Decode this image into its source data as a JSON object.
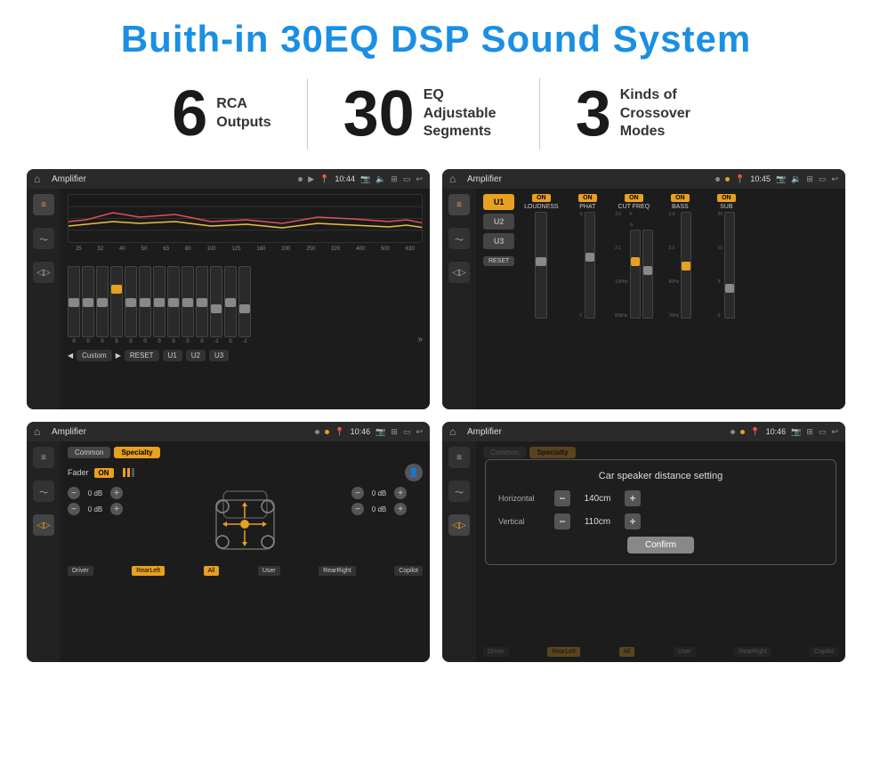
{
  "title": "Buith-in 30EQ DSP Sound System",
  "stats": [
    {
      "number": "6",
      "label": "RCA\nOutputs"
    },
    {
      "number": "30",
      "label": "EQ Adjustable\nSegments"
    },
    {
      "number": "3",
      "label": "Kinds of\nCrossover Modes"
    }
  ],
  "screens": [
    {
      "id": "eq-screen",
      "title": "Amplifier",
      "time": "10:44",
      "description": "30-band EQ screen",
      "freq_labels": [
        "25",
        "32",
        "40",
        "50",
        "63",
        "80",
        "100",
        "125",
        "160",
        "200",
        "250",
        "320",
        "400",
        "500",
        "630"
      ],
      "slider_values": [
        "0",
        "0",
        "0",
        "5",
        "0",
        "0",
        "0",
        "0",
        "0",
        "0",
        "-1",
        "0",
        "-1"
      ],
      "buttons": [
        "Custom",
        "RESET",
        "U1",
        "U2",
        "U3"
      ]
    },
    {
      "id": "crossover-screen",
      "title": "Amplifier",
      "time": "10:45",
      "description": "Crossover modes screen",
      "u_buttons": [
        "U1",
        "U2",
        "U3"
      ],
      "channels": [
        "LOUDNESS",
        "PHAT",
        "CUT FREQ",
        "BASS",
        "SUB"
      ],
      "channel_states": [
        "ON",
        "ON",
        "ON",
        "ON",
        "ON"
      ]
    },
    {
      "id": "fader-screen",
      "title": "Amplifier",
      "time": "10:46",
      "description": "Fader control screen",
      "tabs": [
        "Common",
        "Specialty"
      ],
      "fader_label": "Fader",
      "fader_on": "ON",
      "db_values": [
        "0 dB",
        "0 dB",
        "0 dB",
        "0 dB"
      ],
      "bottom_labels": [
        "Driver",
        "RearLeft",
        "All",
        "User",
        "RearRight",
        "Copilot"
      ]
    },
    {
      "id": "distance-screen",
      "title": "Amplifier",
      "time": "10:46",
      "description": "Car speaker distance setting",
      "dialog_title": "Car speaker distance setting",
      "horizontal_label": "Horizontal",
      "horizontal_value": "140cm",
      "vertical_label": "Vertical",
      "vertical_value": "110cm",
      "confirm_label": "Confirm",
      "tabs": [
        "Common",
        "Specialty"
      ],
      "bottom_labels": [
        "Driver",
        "RearLeft",
        "All",
        "User",
        "RearRight",
        "Copilot"
      ]
    }
  ],
  "colors": {
    "accent": "#1a8fe3",
    "orange": "#e8a020",
    "dark_bg": "#1c1c1c",
    "darker_bg": "#1a1a1a",
    "text_light": "#dddddd",
    "text_muted": "#888888"
  }
}
